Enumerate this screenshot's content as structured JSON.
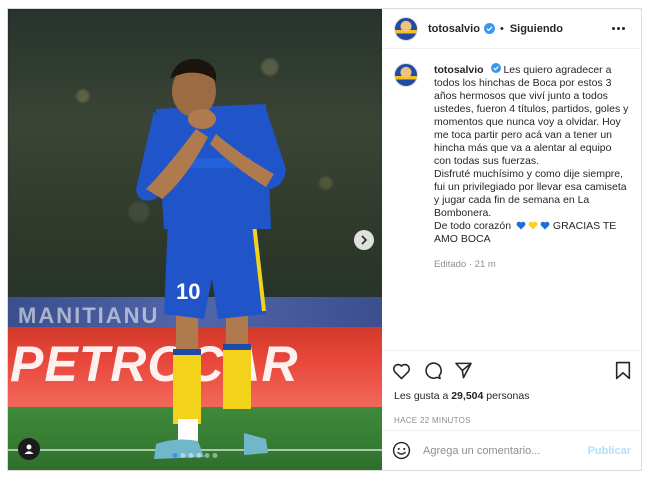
{
  "post": {
    "banner_text_top": "MANITIANU",
    "banner_text_red": "PETROCAR",
    "jersey_number": "10",
    "dots_count": 6,
    "active_dot": 0
  },
  "header": {
    "username": "totosalvio",
    "separator": "•",
    "follow_status": "Siguiendo"
  },
  "caption": {
    "username": "totosalvio",
    "paragraphs": [
      "Les quiero agradecer a todos los hinchas de Boca por estos 3 años hermosos que viví junto a todos ustedes, fueron 4 títulos, partidos, goles y momentos que nunca voy a olvidar. Hoy me toca partir pero acá van a tener un hincha más que va a alentar al equipo con todas sus fuerzas.",
      "Disfruté muchísimo y como dije siempre, fui un privilegiado por llevar esa camiseta y jugar cada fin de semana en La Bombonera.",
      "De todo corazón",
      "GRACIAS TE AMO BOCA"
    ],
    "edited": "Editado · 21 m"
  },
  "stats": {
    "likes_prefix": "Les gusta a",
    "likes_count": "29,504",
    "likes_suffix": "personas",
    "time_ago": "HACE 22 MINUTOS"
  },
  "comment_box": {
    "placeholder": "Agrega un comentario...",
    "publish_label": "Publicar"
  },
  "colors": {
    "verified": "#3897f0",
    "heart_blue": "#1d6fd6",
    "heart_yellow": "#f7d21e",
    "publish_disabled": "#b2dffc"
  },
  "icons": [
    "verified-icon",
    "more-options-icon",
    "like-icon",
    "comment-icon",
    "share-icon",
    "save-icon",
    "emoji-icon",
    "next-arrow-icon",
    "user-tag-icon"
  ]
}
